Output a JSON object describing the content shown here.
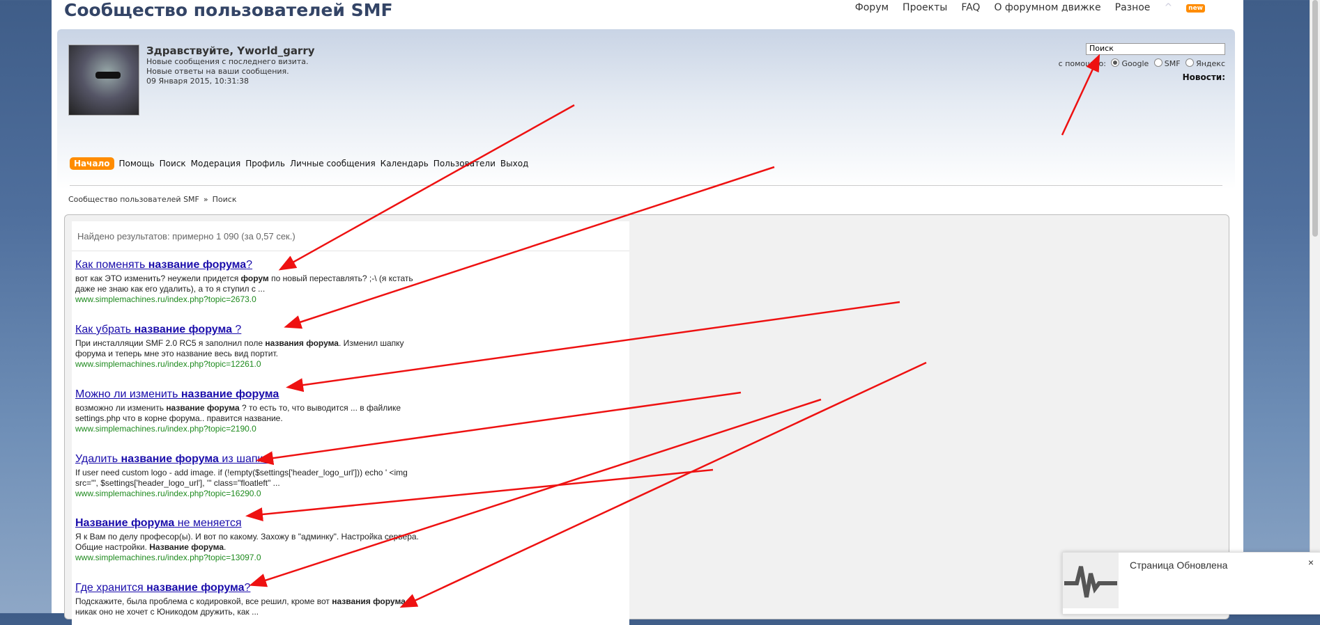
{
  "header": {
    "forum_title": "Сообщество пользователей SMF",
    "nav": [
      "Форум",
      "Проекты",
      "FAQ",
      "О форумном движке",
      "Разное"
    ],
    "new_badge": "new"
  },
  "user": {
    "greeting": "Здравствуйте, Yworld_garry",
    "lines": [
      "Новые сообщения с последнего визита.",
      "Новые ответы на ваши сообщения.",
      "09 Января 2015, 10:31:38"
    ]
  },
  "search": {
    "value": "Поиск",
    "with_label": "с помощью:",
    "engines": [
      {
        "label": "Google",
        "selected": true
      },
      {
        "label": "SMF",
        "selected": false
      },
      {
        "label": "Яндекс",
        "selected": false
      }
    ],
    "news_label": "Новости:"
  },
  "mainnav": [
    "Начало",
    "Помощь",
    "Поиск",
    "Модерация",
    "Профиль",
    "Личные сообщения",
    "Календарь",
    "Пользователи",
    "Выход"
  ],
  "breadcrumb": [
    "Сообщество пользователей SMF",
    "»",
    "Поиск"
  ],
  "results": {
    "count_text": "Найдено результатов: примерно 1 090 (за 0,57 сек.)",
    "items": [
      {
        "title": [
          [
            "Как поменять ",
            false
          ],
          [
            "название форума",
            true
          ],
          [
            "?",
            false
          ]
        ],
        "snippet": [
          [
            "вот как ЭТО изменить? неужели придется ",
            false
          ],
          [
            "форум",
            true
          ],
          [
            " по новый переставлять? ;-\\ (я кстать",
            false
          ],
          [
            "\n",
            false
          ],
          [
            "даже не знаю как его удалить), а то я ступил с ...",
            false
          ]
        ],
        "url": "www.simplemachines.ru/index.php?topic=2673.0"
      },
      {
        "title": [
          [
            "Как убрать ",
            false
          ],
          [
            "название форума",
            true
          ],
          [
            " ?",
            false
          ]
        ],
        "snippet": [
          [
            "При инсталляции SMF 2.0 RC5 я заполнил поле ",
            false
          ],
          [
            "названия форума",
            true
          ],
          [
            ". Изменил шапку",
            false
          ],
          [
            "\n",
            false
          ],
          [
            "форума и теперь мне это название весь вид портит.",
            false
          ]
        ],
        "url": "www.simplemachines.ru/index.php?topic=12261.0"
      },
      {
        "title": [
          [
            "Можно ли изменить ",
            false
          ],
          [
            "название форума",
            true
          ]
        ],
        "snippet": [
          [
            "возможно ли изменить ",
            false
          ],
          [
            "название форума",
            true
          ],
          [
            " ? то есть то, что выводится ... в файлике",
            false
          ],
          [
            "\n",
            false
          ],
          [
            "settings.php что в корне форума.. правится название.",
            false
          ]
        ],
        "url": "www.simplemachines.ru/index.php?topic=2190.0"
      },
      {
        "title": [
          [
            "Удалить ",
            false
          ],
          [
            "название форума",
            true
          ],
          [
            " из шапки",
            false
          ]
        ],
        "snippet": [
          [
            "If user need custom logo - add image. if (!empty($settings['header_logo_url'])) echo ' <img",
            false
          ],
          [
            "\n",
            false
          ],
          [
            "src=\"', $settings['header_logo_url'], '\" class=\"floatleft\" ...",
            false
          ]
        ],
        "url": "www.simplemachines.ru/index.php?topic=16290.0"
      },
      {
        "title": [
          [
            "Название форума",
            true
          ],
          [
            " не меняется",
            false
          ]
        ],
        "snippet": [
          [
            "Я к Вам по делу професор(ы). И вот по какому. Захожу в \"админку\". Настройка сервера.",
            false
          ],
          [
            "\n",
            false
          ],
          [
            "Общие настройки. ",
            false
          ],
          [
            "Название форума",
            true
          ],
          [
            ".",
            false
          ]
        ],
        "url": "www.simplemachines.ru/index.php?topic=13097.0"
      },
      {
        "title": [
          [
            "Где хранится ",
            false
          ],
          [
            "название форума",
            true
          ],
          [
            "?",
            false
          ]
        ],
        "snippet": [
          [
            "Подскажите, была проблема с кодировкой, все решил, кроме вот ",
            false
          ],
          [
            "названия форума",
            true
          ],
          [
            ",",
            false
          ],
          [
            "\n",
            false
          ],
          [
            "никак оно не хочет с Юникодом дружить, как ...",
            false
          ]
        ],
        "url": ""
      }
    ]
  },
  "toast": {
    "message": "Страница Обновлена",
    "close": "×"
  },
  "colors": {
    "accent": "#ff8c00",
    "link": "#1a0dab",
    "url": "#1e8a1e",
    "arrow": "#ee1111"
  }
}
